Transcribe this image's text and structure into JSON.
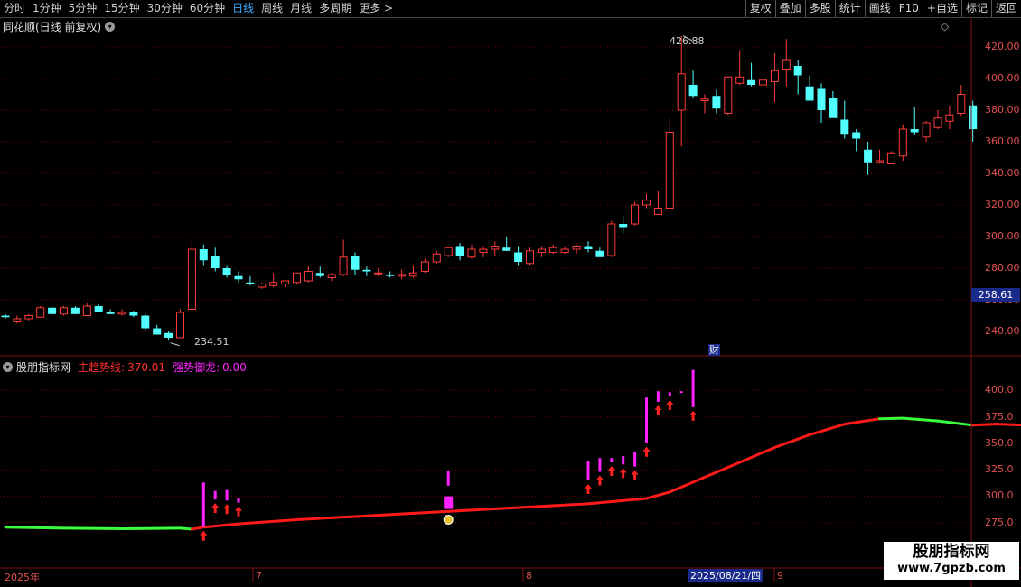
{
  "toolbar": {
    "left_items": [
      "分时",
      "1分钟",
      "5分钟",
      "15分钟",
      "30分钟",
      "60分钟",
      "日线",
      "周线",
      "月线",
      "多周期",
      "更多"
    ],
    "more_arrow": ">",
    "active": "日线",
    "right_buttons": [
      "复权",
      "叠加",
      "多股",
      "统计",
      "画线",
      "F10",
      "+自选",
      "标记",
      "返回"
    ]
  },
  "main_panel": {
    "title": "同花顺(日线 前复权)",
    "diamond": "◇",
    "high_label": "426.88",
    "low_label": "234.51",
    "current_price": "258.61",
    "finance_marker": "财",
    "y_ticks": [
      "420.00",
      "400.00",
      "380.00",
      "360.00",
      "340.00",
      "320.00",
      "300.00",
      "280.00",
      "260.00",
      "240.00"
    ]
  },
  "indicator_panel": {
    "name": "股朋指标网",
    "line1_label": "主趋势线:",
    "line1_value": "370.01",
    "line2_label": "强势御龙:",
    "line2_value": "0.00",
    "y_ticks": [
      "400.0",
      "375.0",
      "350.0",
      "325.0",
      "300.0",
      "275.0"
    ]
  },
  "x_axis": {
    "labels": [
      "2025年",
      "7",
      "8",
      "9"
    ],
    "cursor_date": "2025/08/21/四"
  },
  "watermark": {
    "line1": "股朋指标网",
    "line2": "www.7gpzb.com"
  },
  "colors": {
    "up": "#ff3b3b",
    "down": "#52ffff",
    "trend_up": "#ff1a1a",
    "trend_down": "#3cff3c",
    "signal": "#ff22ff",
    "axis": "#e05050",
    "grid": "#6a0000"
  },
  "chart_data": {
    "type": "candlestick",
    "title": "同花顺(日线 前复权)",
    "ylim": [
      232,
      432
    ],
    "candles": [
      [
        250,
        251,
        248,
        249
      ],
      [
        246,
        250,
        245,
        248
      ],
      [
        248,
        251,
        247,
        250
      ],
      [
        249,
        256,
        249,
        255
      ],
      [
        255,
        256,
        250,
        251
      ],
      [
        251,
        256,
        250,
        255
      ],
      [
        255,
        256,
        251,
        251
      ],
      [
        250,
        258,
        250,
        256
      ],
      [
        256,
        257,
        252,
        252
      ],
      [
        252,
        254,
        251,
        251
      ],
      [
        251,
        254,
        250,
        252
      ],
      [
        252,
        253,
        249,
        250
      ],
      [
        250,
        251,
        240,
        242
      ],
      [
        242,
        244,
        238,
        238
      ],
      [
        239,
        240,
        234.51,
        236
      ],
      [
        236,
        254,
        236,
        252
      ],
      [
        254,
        298,
        254,
        292
      ],
      [
        292,
        295,
        282,
        285
      ],
      [
        288,
        293,
        278,
        280
      ],
      [
        280,
        282,
        274,
        276
      ],
      [
        275,
        278,
        271,
        273
      ],
      [
        271,
        275,
        269,
        270
      ],
      [
        268,
        271,
        267,
        270
      ],
      [
        269,
        277,
        268,
        271
      ],
      [
        270,
        272,
        268,
        272
      ],
      [
        271,
        276,
        270,
        277
      ],
      [
        272,
        281,
        271,
        278
      ],
      [
        277,
        281,
        274,
        275
      ],
      [
        274,
        277,
        272,
        276
      ],
      [
        276,
        298,
        275,
        287
      ],
      [
        288,
        290,
        276,
        279
      ],
      [
        279,
        281,
        275,
        278
      ],
      [
        277,
        280,
        275,
        277
      ],
      [
        276,
        278,
        274,
        275
      ],
      [
        275,
        279,
        273,
        276
      ],
      [
        275,
        282,
        274,
        277
      ],
      [
        278,
        286,
        277,
        284
      ],
      [
        284,
        291,
        283,
        289
      ],
      [
        288,
        293,
        287,
        293
      ],
      [
        294,
        296,
        285,
        288
      ],
      [
        287,
        295,
        286,
        292
      ],
      [
        290,
        294,
        287,
        292
      ],
      [
        292,
        297,
        288,
        294
      ],
      [
        293,
        300,
        291,
        291
      ],
      [
        290,
        294,
        282,
        284
      ],
      [
        283,
        293,
        282,
        291
      ],
      [
        290,
        294,
        287,
        292
      ],
      [
        290,
        295,
        289,
        293
      ],
      [
        290,
        294,
        289,
        292
      ],
      [
        292,
        295,
        289,
        294
      ],
      [
        294,
        297,
        290,
        292
      ],
      [
        291,
        293,
        287,
        287
      ],
      [
        288,
        310,
        287,
        308
      ],
      [
        308,
        313,
        302,
        306
      ],
      [
        308,
        322,
        307,
        320
      ],
      [
        320,
        327,
        318,
        323
      ],
      [
        314,
        329,
        314,
        318
      ],
      [
        318,
        375,
        318,
        366
      ],
      [
        380,
        427,
        357,
        403
      ],
      [
        396,
        405,
        388,
        389
      ],
      [
        386,
        390,
        378,
        387
      ],
      [
        389,
        393,
        378,
        381
      ],
      [
        378,
        400,
        377,
        401
      ],
      [
        397,
        418,
        396,
        401
      ],
      [
        399,
        410,
        395,
        396
      ],
      [
        396,
        419,
        385,
        399
      ],
      [
        398,
        416,
        385,
        405
      ],
      [
        406,
        425,
        395,
        412
      ],
      [
        408,
        412,
        390,
        402
      ],
      [
        395,
        402,
        388,
        386
      ],
      [
        394,
        397,
        372,
        380
      ],
      [
        388,
        392,
        377,
        375
      ],
      [
        374,
        386,
        362,
        365
      ],
      [
        366,
        368,
        354,
        362
      ],
      [
        355,
        360,
        339,
        347
      ],
      [
        347,
        355,
        346,
        348
      ],
      [
        346,
        354,
        346,
        353
      ],
      [
        351,
        371,
        348,
        368
      ],
      [
        368,
        382,
        364,
        366
      ],
      [
        363,
        373,
        360,
        372
      ],
      [
        369,
        380,
        368,
        375
      ],
      [
        373,
        383,
        368,
        377
      ],
      [
        378,
        396,
        376,
        390
      ],
      [
        383,
        386,
        360,
        368
      ]
    ],
    "indicator": {
      "name": "股朋指标网",
      "ylim": [
        258,
        420
      ],
      "trend_line": [
        [
          0,
          271,
          0
        ],
        [
          5,
          270,
          0
        ],
        [
          10,
          269.5,
          0
        ],
        [
          15,
          270,
          0
        ],
        [
          16,
          269,
          0
        ],
        [
          17,
          271,
          1
        ],
        [
          20,
          274,
          1
        ],
        [
          25,
          278,
          1
        ],
        [
          30,
          281,
          1
        ],
        [
          35,
          284,
          1
        ],
        [
          40,
          287,
          1
        ],
        [
          45,
          290,
          1
        ],
        [
          50,
          293,
          1
        ],
        [
          55,
          298,
          1
        ],
        [
          57,
          304,
          1
        ],
        [
          60,
          318,
          1
        ],
        [
          63,
          332,
          1
        ],
        [
          66,
          346,
          1
        ],
        [
          69,
          358,
          1
        ],
        [
          72,
          368,
          1
        ],
        [
          75,
          373,
          1
        ],
        [
          77,
          373.5,
          0
        ],
        [
          80,
          371,
          0
        ],
        [
          83,
          367,
          0
        ],
        [
          85,
          368,
          1
        ],
        [
          88,
          367,
          1
        ]
      ],
      "signal_bars": [
        [
          17,
          271,
          313
        ],
        [
          18,
          297,
          305
        ],
        [
          19,
          296,
          306
        ],
        [
          20,
          294,
          298
        ],
        [
          38,
          310,
          324
        ],
        [
          50,
          315,
          333
        ],
        [
          51,
          323,
          336
        ],
        [
          52,
          332,
          336
        ],
        [
          53,
          330,
          338
        ],
        [
          54,
          328,
          342
        ],
        [
          55,
          350,
          393
        ],
        [
          56,
          389,
          399
        ],
        [
          57,
          394,
          398
        ],
        [
          58,
          398,
          399
        ],
        [
          59,
          384,
          419
        ]
      ],
      "arrows": [
        17,
        18,
        19,
        20,
        50,
        51,
        52,
        53,
        54,
        55,
        56,
        57,
        59
      ],
      "money_icon_index": 38
    }
  }
}
